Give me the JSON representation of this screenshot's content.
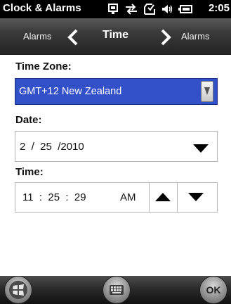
{
  "statusbar": {
    "app_title": "Clock & Alarms",
    "clock": "2:05",
    "icons": [
      "phone-card-icon",
      "sync-arrows-icon",
      "inbox-icon",
      "volume-icon",
      "battery-icon"
    ]
  },
  "navbar": {
    "left_label": "Alarms",
    "title": "Time",
    "right_label": "Alarms",
    "icons": [
      "chevron-left-icon",
      "chevron-right-icon"
    ]
  },
  "timezone": {
    "label": "Time Zone:",
    "value": "GMT+12 New Zealand"
  },
  "date": {
    "label": "Date:",
    "value": "2  /  25  /2010"
  },
  "time": {
    "label": "Time:",
    "value": "11  :  25  :  29",
    "ampm": "AM"
  },
  "bottombar": {
    "ok_label": "OK",
    "icons": [
      "windows-start-icon",
      "keyboard-icon"
    ]
  },
  "colors": {
    "selection": "#3250c8",
    "statusbar": "#000000",
    "titlebar": "#2e2e2e"
  }
}
